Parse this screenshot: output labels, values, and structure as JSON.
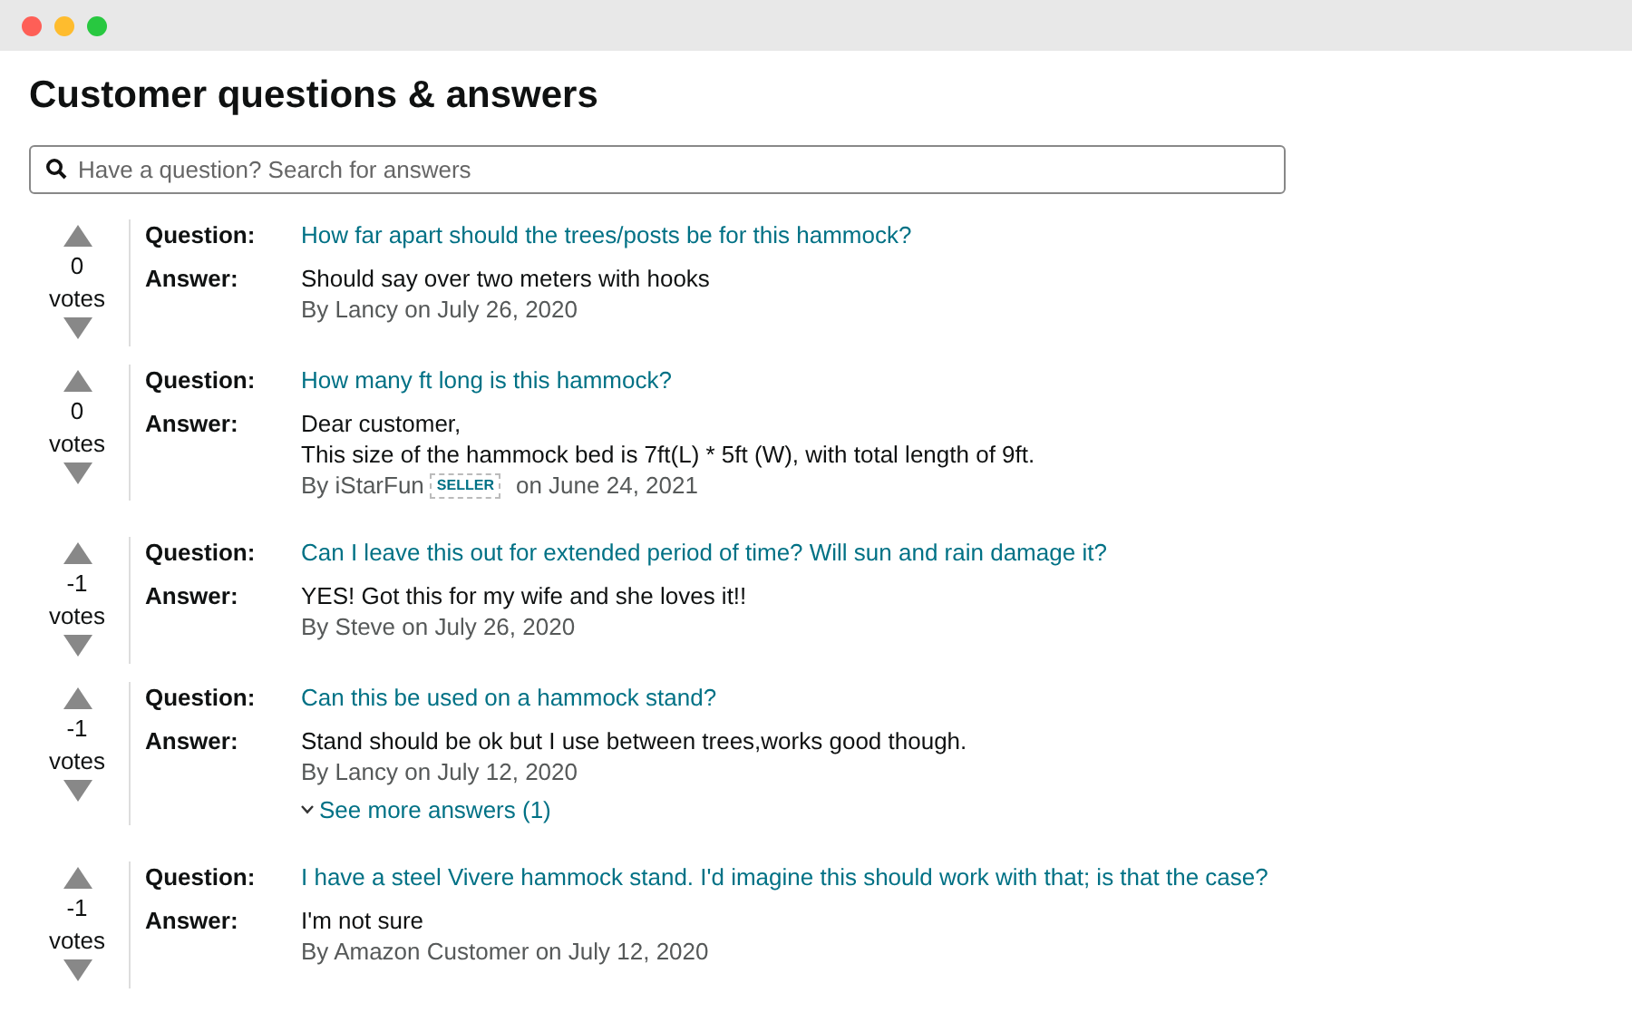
{
  "title": "Customer questions & answers",
  "search": {
    "placeholder": "Have a question? Search for answers"
  },
  "items": [
    {
      "votes": "0",
      "votes_label": "votes",
      "question_label": "Question:",
      "question": "How far apart should the trees/posts be for this hammock?",
      "answer_label": "Answer:",
      "answer": [
        "Should say over two meters with hooks"
      ],
      "byline": "By Lancy on July 26, 2020"
    },
    {
      "votes": "0",
      "votes_label": "votes",
      "question_label": "Question:",
      "question": "How many ft long is this hammock?",
      "answer_label": "Answer:",
      "answer": [
        "Dear customer,",
        "This size of the hammock bed is 7ft(L) * 5ft (W), with total length of 9ft."
      ],
      "byline": "By iStarFun",
      "badge": "SELLER",
      "byline_end": "on June 24, 2021"
    },
    {
      "votes": "-1",
      "votes_label": "votes",
      "question_label": "Question:",
      "question": "Can I leave this out for extended period of time? Will sun and rain damage it?",
      "answer_label": "Answer:",
      "answer": [
        "YES! Got this for my wife and she loves it!!"
      ],
      "byline": "By Steve on July 26, 2020"
    },
    {
      "votes": "-1",
      "votes_label": "votes",
      "question_label": "Question:",
      "question": "Can this be used on a hammock stand?",
      "answer_label": "Answer:",
      "answer": [
        "Stand should be ok but I use between trees,works good though."
      ],
      "byline": "By Lancy on July 12, 2020",
      "more": "See more answers (1)"
    },
    {
      "votes": "-1",
      "votes_label": "votes",
      "question_label": "Question:",
      "question": "I have a steel Vivere hammock stand. I'd imagine this should work with that; is that the case?",
      "answer_label": "Answer:",
      "answer": [
        "I'm not sure"
      ],
      "byline": "By Amazon Customer on July 12, 2020"
    }
  ]
}
